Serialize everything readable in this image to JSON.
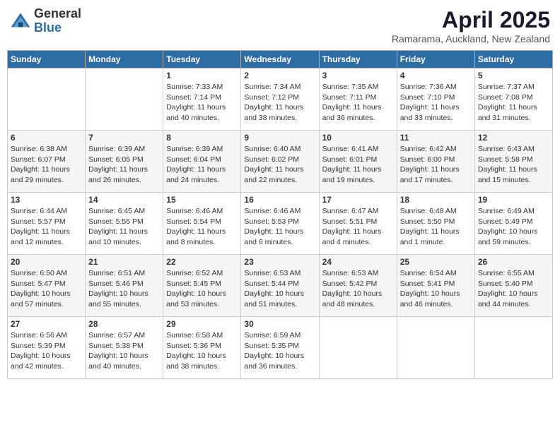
{
  "logo": {
    "general": "General",
    "blue": "Blue"
  },
  "header": {
    "month_year": "April 2025",
    "location": "Ramarama, Auckland, New Zealand"
  },
  "days_of_week": [
    "Sunday",
    "Monday",
    "Tuesday",
    "Wednesday",
    "Thursday",
    "Friday",
    "Saturday"
  ],
  "weeks": [
    [
      {
        "day": null,
        "sunrise": null,
        "sunset": null,
        "daylight": null
      },
      {
        "day": null,
        "sunrise": null,
        "sunset": null,
        "daylight": null
      },
      {
        "day": "1",
        "sunrise": "Sunrise: 7:33 AM",
        "sunset": "Sunset: 7:14 PM",
        "daylight": "Daylight: 11 hours and 40 minutes."
      },
      {
        "day": "2",
        "sunrise": "Sunrise: 7:34 AM",
        "sunset": "Sunset: 7:12 PM",
        "daylight": "Daylight: 11 hours and 38 minutes."
      },
      {
        "day": "3",
        "sunrise": "Sunrise: 7:35 AM",
        "sunset": "Sunset: 7:11 PM",
        "daylight": "Daylight: 11 hours and 36 minutes."
      },
      {
        "day": "4",
        "sunrise": "Sunrise: 7:36 AM",
        "sunset": "Sunset: 7:10 PM",
        "daylight": "Daylight: 11 hours and 33 minutes."
      },
      {
        "day": "5",
        "sunrise": "Sunrise: 7:37 AM",
        "sunset": "Sunset: 7:08 PM",
        "daylight": "Daylight: 11 hours and 31 minutes."
      }
    ],
    [
      {
        "day": "6",
        "sunrise": "Sunrise: 6:38 AM",
        "sunset": "Sunset: 6:07 PM",
        "daylight": "Daylight: 11 hours and 29 minutes."
      },
      {
        "day": "7",
        "sunrise": "Sunrise: 6:39 AM",
        "sunset": "Sunset: 6:05 PM",
        "daylight": "Daylight: 11 hours and 26 minutes."
      },
      {
        "day": "8",
        "sunrise": "Sunrise: 6:39 AM",
        "sunset": "Sunset: 6:04 PM",
        "daylight": "Daylight: 11 hours and 24 minutes."
      },
      {
        "day": "9",
        "sunrise": "Sunrise: 6:40 AM",
        "sunset": "Sunset: 6:02 PM",
        "daylight": "Daylight: 11 hours and 22 minutes."
      },
      {
        "day": "10",
        "sunrise": "Sunrise: 6:41 AM",
        "sunset": "Sunset: 6:01 PM",
        "daylight": "Daylight: 11 hours and 19 minutes."
      },
      {
        "day": "11",
        "sunrise": "Sunrise: 6:42 AM",
        "sunset": "Sunset: 6:00 PM",
        "daylight": "Daylight: 11 hours and 17 minutes."
      },
      {
        "day": "12",
        "sunrise": "Sunrise: 6:43 AM",
        "sunset": "Sunset: 5:58 PM",
        "daylight": "Daylight: 11 hours and 15 minutes."
      }
    ],
    [
      {
        "day": "13",
        "sunrise": "Sunrise: 6:44 AM",
        "sunset": "Sunset: 5:57 PM",
        "daylight": "Daylight: 11 hours and 12 minutes."
      },
      {
        "day": "14",
        "sunrise": "Sunrise: 6:45 AM",
        "sunset": "Sunset: 5:55 PM",
        "daylight": "Daylight: 11 hours and 10 minutes."
      },
      {
        "day": "15",
        "sunrise": "Sunrise: 6:46 AM",
        "sunset": "Sunset: 5:54 PM",
        "daylight": "Daylight: 11 hours and 8 minutes."
      },
      {
        "day": "16",
        "sunrise": "Sunrise: 6:46 AM",
        "sunset": "Sunset: 5:53 PM",
        "daylight": "Daylight: 11 hours and 6 minutes."
      },
      {
        "day": "17",
        "sunrise": "Sunrise: 6:47 AM",
        "sunset": "Sunset: 5:51 PM",
        "daylight": "Daylight: 11 hours and 4 minutes."
      },
      {
        "day": "18",
        "sunrise": "Sunrise: 6:48 AM",
        "sunset": "Sunset: 5:50 PM",
        "daylight": "Daylight: 11 hours and 1 minute."
      },
      {
        "day": "19",
        "sunrise": "Sunrise: 6:49 AM",
        "sunset": "Sunset: 5:49 PM",
        "daylight": "Daylight: 10 hours and 59 minutes."
      }
    ],
    [
      {
        "day": "20",
        "sunrise": "Sunrise: 6:50 AM",
        "sunset": "Sunset: 5:47 PM",
        "daylight": "Daylight: 10 hours and 57 minutes."
      },
      {
        "day": "21",
        "sunrise": "Sunrise: 6:51 AM",
        "sunset": "Sunset: 5:46 PM",
        "daylight": "Daylight: 10 hours and 55 minutes."
      },
      {
        "day": "22",
        "sunrise": "Sunrise: 6:52 AM",
        "sunset": "Sunset: 5:45 PM",
        "daylight": "Daylight: 10 hours and 53 minutes."
      },
      {
        "day": "23",
        "sunrise": "Sunrise: 6:53 AM",
        "sunset": "Sunset: 5:44 PM",
        "daylight": "Daylight: 10 hours and 51 minutes."
      },
      {
        "day": "24",
        "sunrise": "Sunrise: 6:53 AM",
        "sunset": "Sunset: 5:42 PM",
        "daylight": "Daylight: 10 hours and 48 minutes."
      },
      {
        "day": "25",
        "sunrise": "Sunrise: 6:54 AM",
        "sunset": "Sunset: 5:41 PM",
        "daylight": "Daylight: 10 hours and 46 minutes."
      },
      {
        "day": "26",
        "sunrise": "Sunrise: 6:55 AM",
        "sunset": "Sunset: 5:40 PM",
        "daylight": "Daylight: 10 hours and 44 minutes."
      }
    ],
    [
      {
        "day": "27",
        "sunrise": "Sunrise: 6:56 AM",
        "sunset": "Sunset: 5:39 PM",
        "daylight": "Daylight: 10 hours and 42 minutes."
      },
      {
        "day": "28",
        "sunrise": "Sunrise: 6:57 AM",
        "sunset": "Sunset: 5:38 PM",
        "daylight": "Daylight: 10 hours and 40 minutes."
      },
      {
        "day": "29",
        "sunrise": "Sunrise: 6:58 AM",
        "sunset": "Sunset: 5:36 PM",
        "daylight": "Daylight: 10 hours and 38 minutes."
      },
      {
        "day": "30",
        "sunrise": "Sunrise: 6:59 AM",
        "sunset": "Sunset: 5:35 PM",
        "daylight": "Daylight: 10 hours and 36 minutes."
      },
      {
        "day": null,
        "sunrise": null,
        "sunset": null,
        "daylight": null
      },
      {
        "day": null,
        "sunrise": null,
        "sunset": null,
        "daylight": null
      },
      {
        "day": null,
        "sunrise": null,
        "sunset": null,
        "daylight": null
      }
    ]
  ]
}
